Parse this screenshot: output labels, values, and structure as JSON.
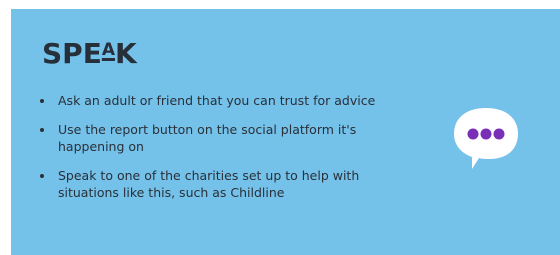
{
  "heading": {
    "prefix": "SPE",
    "accent": "A",
    "suffix": "K"
  },
  "bullets": [
    {
      "text": "Ask an adult or friend that you can trust for advice"
    },
    {
      "text": "Use the report button on the social platform it's happening on"
    },
    {
      "text": "Speak to one of the charities set up to help with situations like this, such as Childline"
    }
  ],
  "icon": {
    "name": "speech-bubble-icon",
    "bubble_color": "#ffffff",
    "dots_color": "#7a2fb7"
  },
  "colors": {
    "background": "#74c1ea",
    "text": "#2a3038",
    "heading": "#262f3a"
  }
}
